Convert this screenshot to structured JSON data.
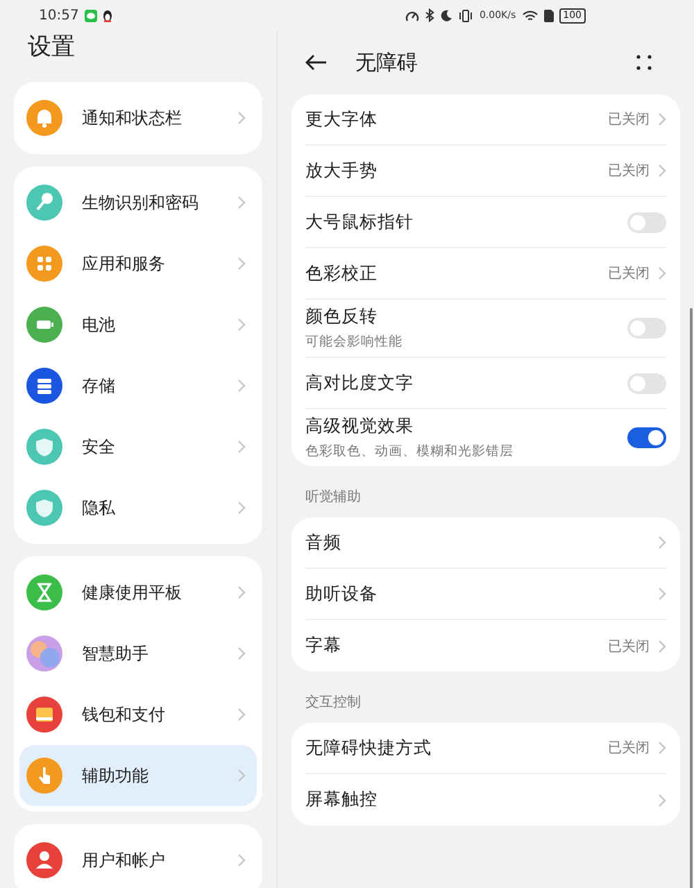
{
  "status_bar": {
    "time": "10:57",
    "network_speed": "0.00K/s",
    "battery": "100"
  },
  "sidebar": {
    "title": "设置",
    "groups": [
      {
        "items": [
          {
            "label": "通知和状态栏",
            "color": "#f39a1e",
            "selected": false
          }
        ]
      },
      {
        "items": [
          {
            "label": "生物识别和密码",
            "color": "#4cc7b2",
            "selected": false
          },
          {
            "label": "应用和服务",
            "color": "#f39a1e",
            "selected": false
          },
          {
            "label": "电池",
            "color": "#4cb050",
            "selected": false
          },
          {
            "label": "存储",
            "color": "#1a56e0",
            "selected": false
          },
          {
            "label": "安全",
            "color": "#4cc7b2",
            "selected": false
          },
          {
            "label": "隐私",
            "color": "#4cc7b2",
            "selected": false
          }
        ]
      },
      {
        "items": [
          {
            "label": "健康使用平板",
            "color": "#3cbd4a",
            "selected": false
          },
          {
            "label": "智慧助手",
            "color": "#c9a0e8",
            "selected": false
          },
          {
            "label": "钱包和支付",
            "color": "#e8403a",
            "selected": false
          },
          {
            "label": "辅助功能",
            "color": "#f39a1e",
            "selected": true
          }
        ]
      },
      {
        "items": [
          {
            "label": "用户和帐户",
            "color": "#e8403a",
            "selected": false
          }
        ]
      }
    ]
  },
  "detail": {
    "title": "无障碍",
    "sections": [
      {
        "rows": [
          {
            "kind": "link",
            "label": "更大字体",
            "value": "已关闭"
          },
          {
            "kind": "link",
            "label": "放大手势",
            "value": "已关闭"
          },
          {
            "kind": "toggle",
            "label": "大号鼠标指针",
            "on": false
          },
          {
            "kind": "link",
            "label": "色彩校正",
            "value": "已关闭"
          },
          {
            "kind": "toggle",
            "label": "颜色反转",
            "subtitle": "可能会影响性能",
            "on": false
          },
          {
            "kind": "toggle",
            "label": "高对比度文字",
            "on": false
          },
          {
            "kind": "toggle",
            "label": "高级视觉效果",
            "subtitle": "色彩取色、动画、模糊和光影错层",
            "on": true
          }
        ]
      },
      {
        "heading": "听觉辅助",
        "rows": [
          {
            "kind": "link",
            "label": "音频"
          },
          {
            "kind": "link",
            "label": "助听设备"
          },
          {
            "kind": "link",
            "label": "字幕",
            "value": "已关闭"
          }
        ]
      },
      {
        "heading": "交互控制",
        "rows": [
          {
            "kind": "link",
            "label": "无障碍快捷方式",
            "value": "已关闭"
          },
          {
            "kind": "link",
            "label": "屏幕触控"
          }
        ]
      }
    ]
  }
}
